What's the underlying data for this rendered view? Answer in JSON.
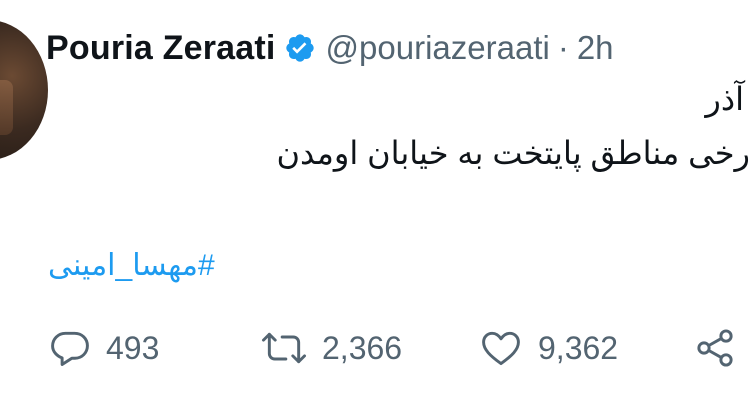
{
  "author": {
    "name": "Pouria Zeraati",
    "handle": "@pouriazeraati",
    "separator": "·",
    "time": "2h",
    "verified_color": "#1d9bf0"
  },
  "tweet": {
    "lines": [
      "آذر",
      "رخی مناطق پایتخت به خیابان اومدن"
    ],
    "hashtag": "#مهسا_امینی"
  },
  "actions": {
    "reply": {
      "icon": "reply-icon",
      "count": "493"
    },
    "retweet": {
      "icon": "retweet-icon",
      "count": "2,366"
    },
    "like": {
      "icon": "heart-icon",
      "count": "9,362"
    },
    "share": {
      "icon": "share-icon"
    }
  },
  "colors": {
    "text": "#0f1419",
    "muted": "#536471",
    "link": "#1d9bf0"
  }
}
